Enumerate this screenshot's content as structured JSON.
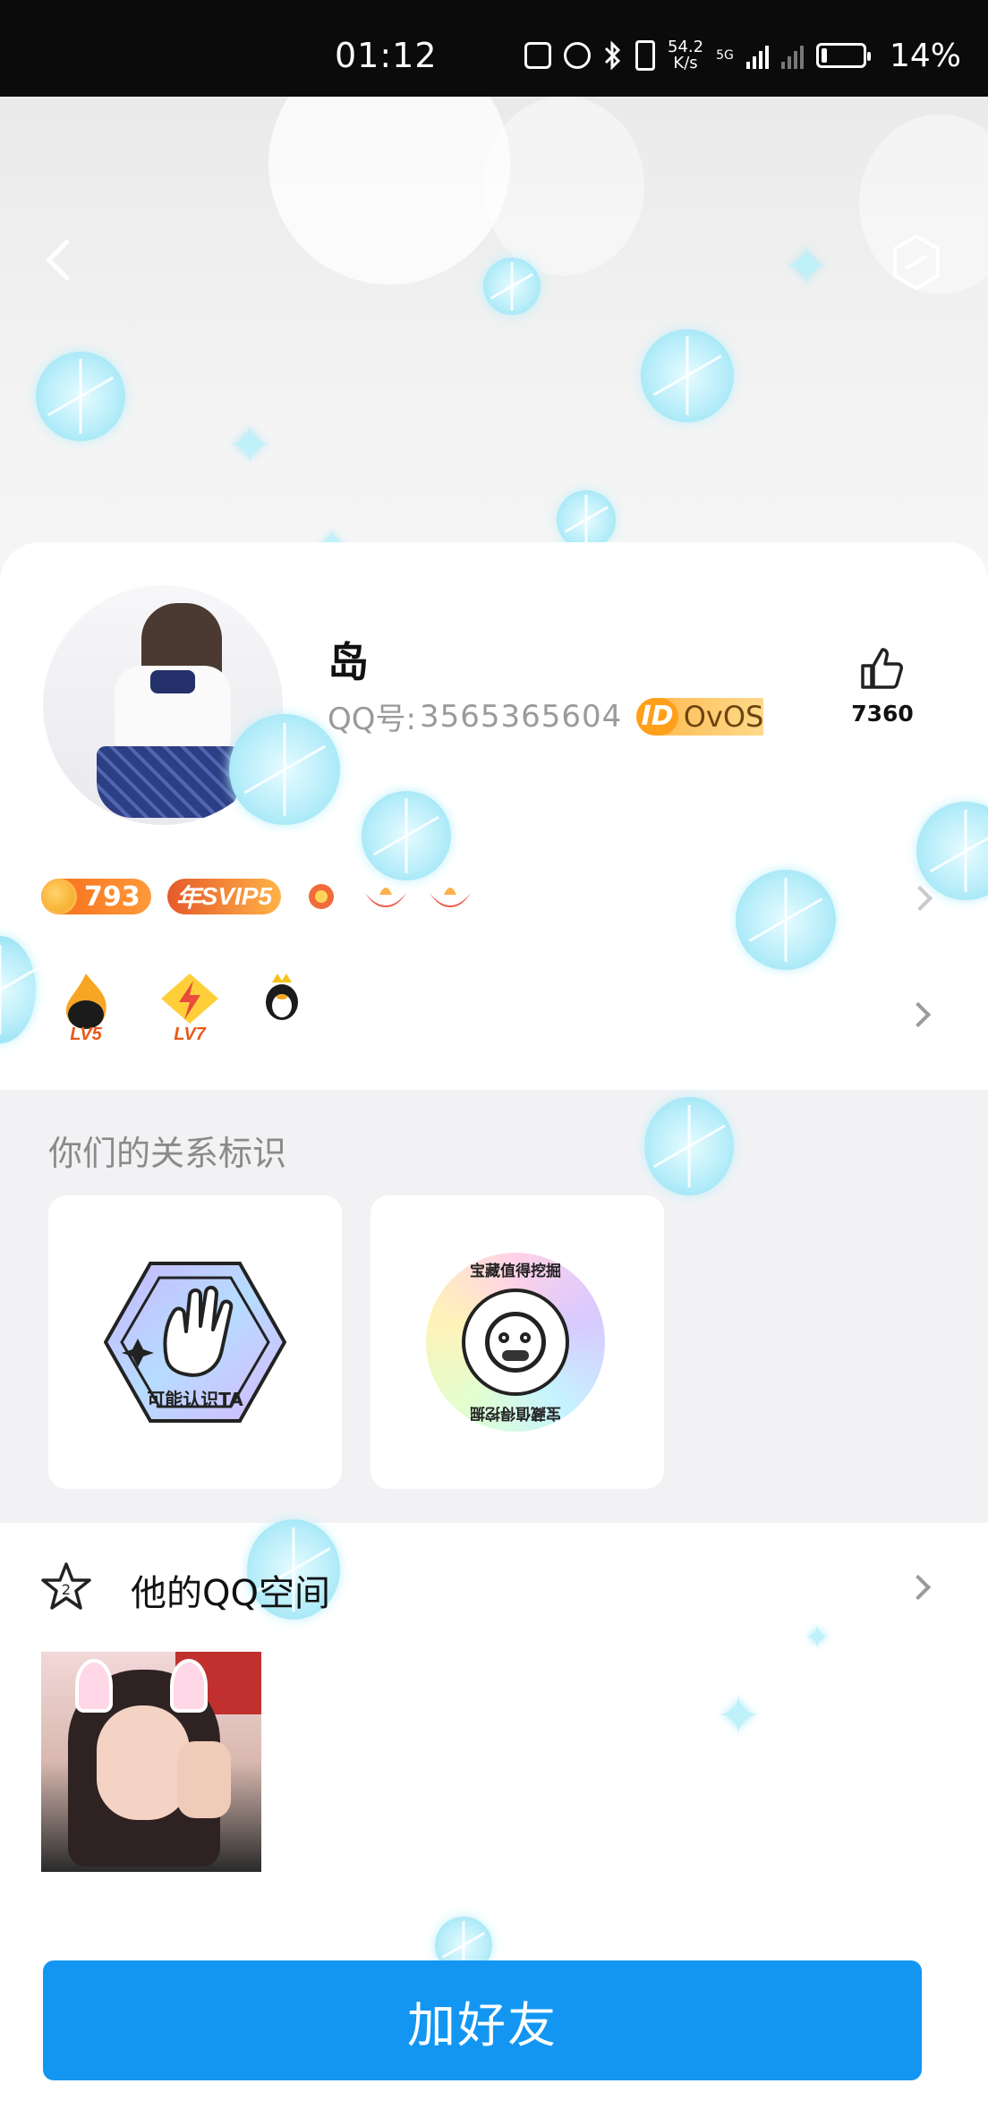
{
  "status_bar": {
    "time": "01:12",
    "net_speed_value": "54.2",
    "net_speed_unit": "K/s",
    "network": "5G",
    "battery_pct": "14%",
    "battery_level": 0.14
  },
  "header": {
    "back_icon": "back-chevron-icon",
    "settings_icon": "hexagon-icon"
  },
  "profile": {
    "nickname": "岛",
    "qq_label": "QQ号:",
    "qq_number": "3565365604",
    "id_badge_icon": "ID",
    "id_badge_text": "OvOS",
    "likes": "7360",
    "coin_count": "793",
    "svip_label": "SVIP5",
    "svip_prefix": "年",
    "levels": [
      {
        "label": "LV5",
        "icon": "flame-level-icon"
      },
      {
        "label": "LV7",
        "icon": "lightning-level-icon"
      },
      {
        "label": "",
        "icon": "penguin-level-icon"
      }
    ]
  },
  "relation": {
    "title": "你们的关系标识",
    "cards": [
      {
        "label": "可能认识TA",
        "icon": "hand-wave-icon"
      },
      {
        "label": "宝藏值得挖掘",
        "icon": "smiley-seal-icon"
      }
    ]
  },
  "space": {
    "title": "他的QQ空间",
    "icon": "star-2-icon"
  },
  "actions": {
    "add_friend": "加好友"
  },
  "colors": {
    "primary_button": "#1296f2",
    "status_bar_bg": "#0b0b0b",
    "coin_badge": "#f56b18"
  }
}
